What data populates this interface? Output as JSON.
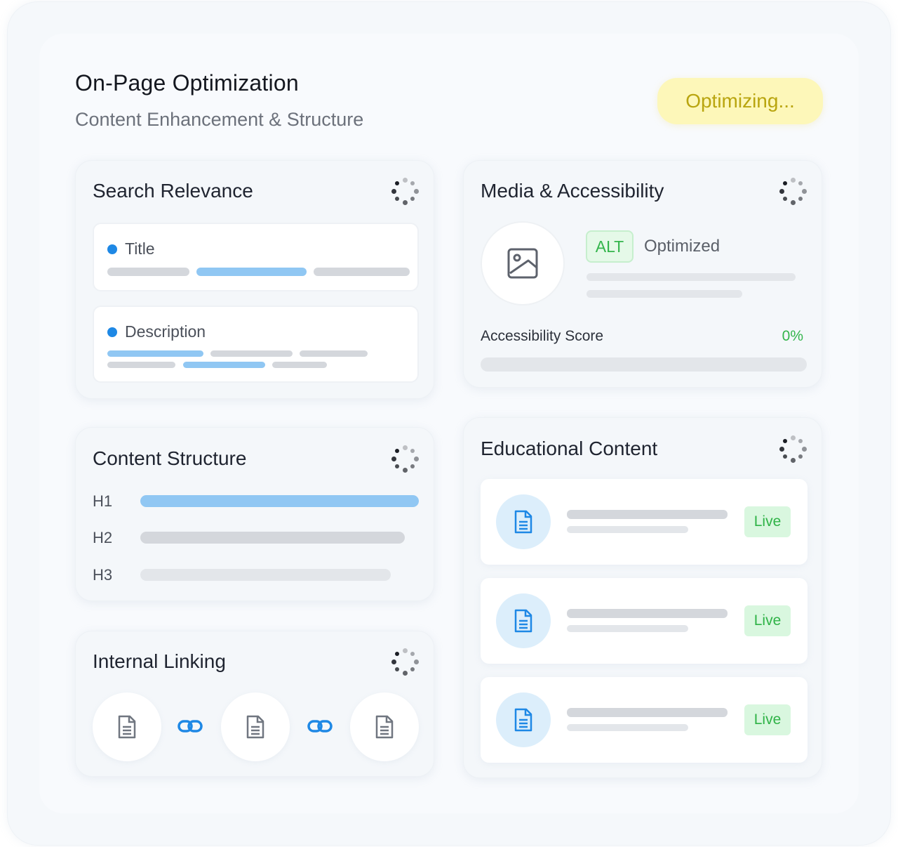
{
  "header": {
    "title": "On-Page Optimization",
    "subtitle": "Content Enhancement & Structure",
    "status": "Optimizing..."
  },
  "search_relevance": {
    "title": "Search Relevance",
    "items": [
      {
        "label": "Title"
      },
      {
        "label": "Description"
      }
    ]
  },
  "media": {
    "title": "Media & Accessibility",
    "alt_badge": "ALT",
    "alt_status": "Optimized",
    "score_label": "Accessibility Score",
    "score_value": "0%",
    "score_progress": 0
  },
  "content_structure": {
    "title": "Content Structure",
    "headings": [
      {
        "label": "H1"
      },
      {
        "label": "H2"
      },
      {
        "label": "H3"
      }
    ]
  },
  "internal_linking": {
    "title": "Internal Linking",
    "icons": [
      "document-icon",
      "link-icon",
      "document-icon",
      "link-icon",
      "document-icon"
    ]
  },
  "educational": {
    "title": "Educational Content",
    "items": [
      {
        "status": "Live"
      },
      {
        "status": "Live"
      },
      {
        "status": "Live"
      }
    ]
  },
  "colors": {
    "accent_blue": "#1e88e5",
    "status_yellow": "#fdf7b9",
    "live_green": "#2fb347"
  }
}
